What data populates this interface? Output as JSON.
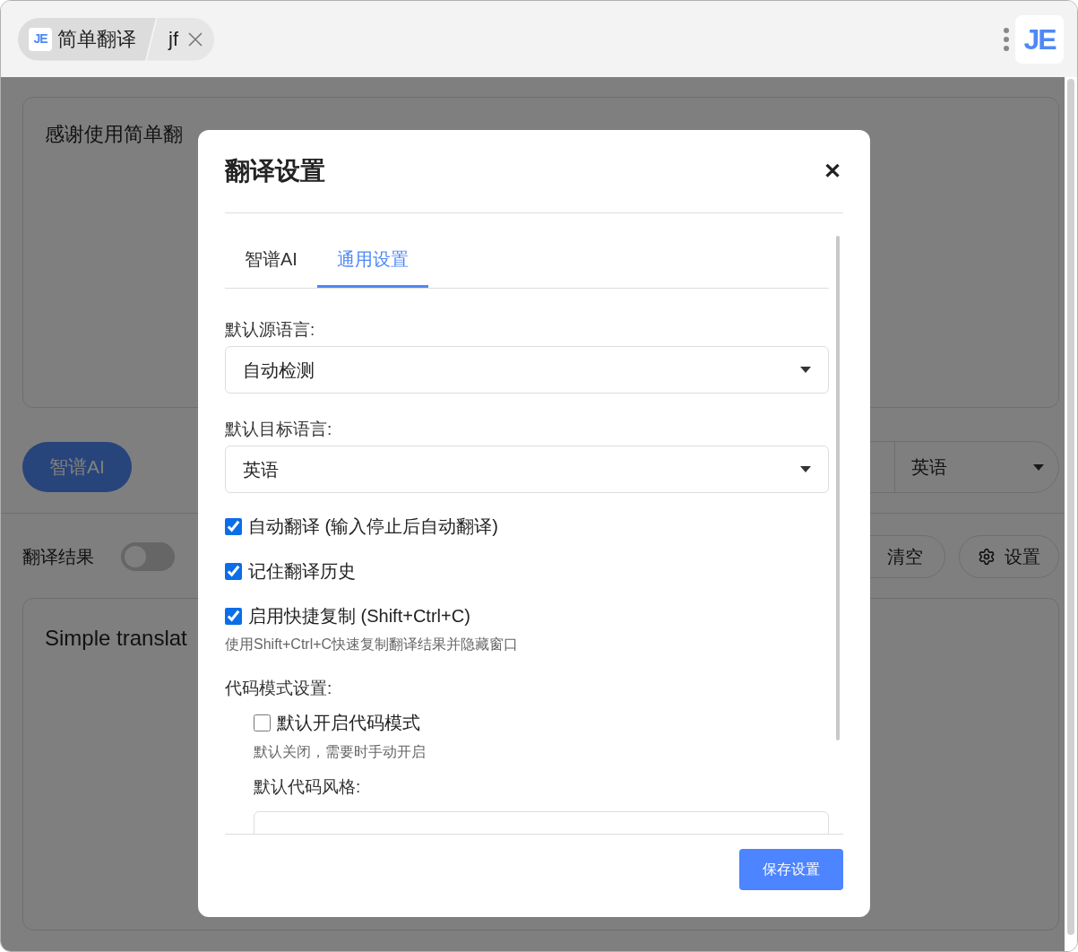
{
  "title_bar": {
    "logo_text": "JE",
    "app_tab": "简单翻译",
    "sub_tab": "jf",
    "corner_logo_text": "JE"
  },
  "input_panel": {
    "text": "感谢使用简单翻"
  },
  "engine_button": "智谱AI",
  "target_language": "英语",
  "result_bar": {
    "label": "翻译结果",
    "toggle_on": false,
    "clear_button": "清空",
    "settings_button": "设置"
  },
  "output_panel": {
    "text": "Simple translat"
  },
  "dialog": {
    "title": "翻译设置",
    "close": "✕",
    "tabs": [
      {
        "label": "智谱AI",
        "selected": false
      },
      {
        "label": "通用设置",
        "selected": true
      }
    ],
    "source_language": {
      "label": "默认源语言:",
      "value": "自动检测"
    },
    "target_language": {
      "label": "默认目标语言:",
      "value": "英语"
    },
    "options": [
      {
        "label": "自动翻译 (输入停止后自动翻译)",
        "checked": true
      },
      {
        "label": "记住翻译历史",
        "checked": true
      },
      {
        "label": "启用快捷复制 (Shift+Ctrl+C)",
        "checked": true,
        "hint": "使用Shift+Ctrl+C快速复制翻译结果并隐藏窗口"
      }
    ],
    "code_mode": {
      "heading": "代码模式设置:",
      "option": {
        "label": "默认开启代码模式",
        "checked": false,
        "hint": "默认关闭，需要时手动开启"
      },
      "style_label": "默认代码风格:"
    },
    "save_button": "保存设置"
  }
}
